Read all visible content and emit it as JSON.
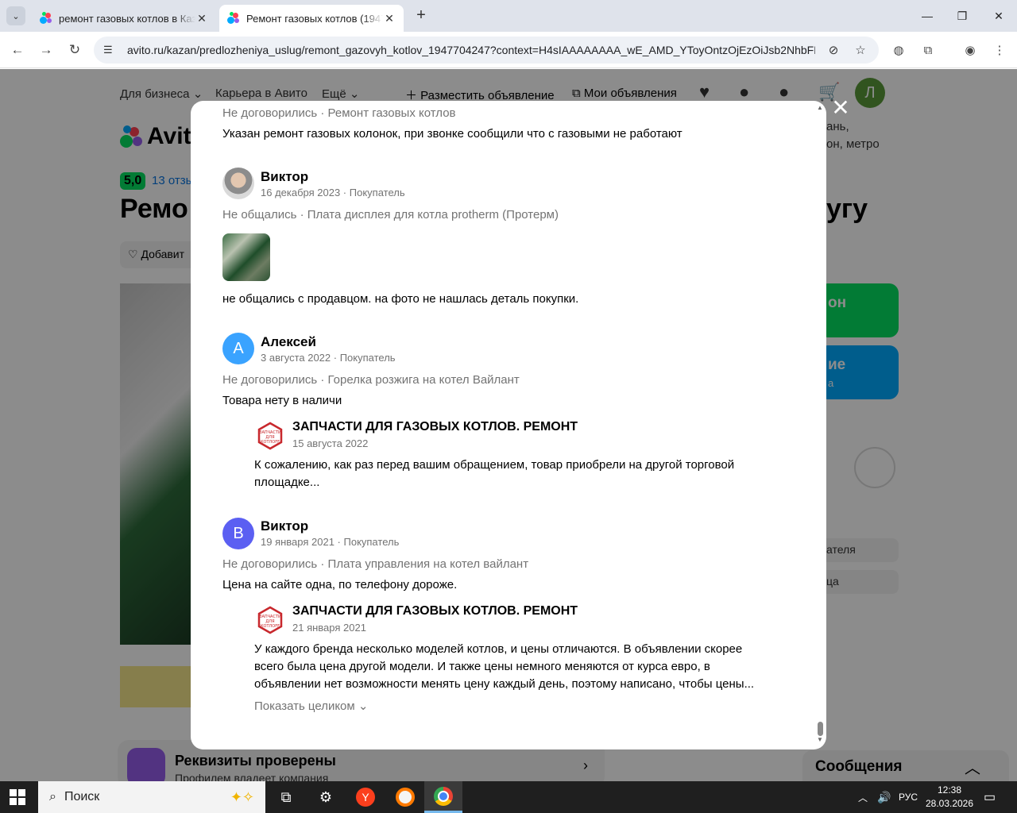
{
  "browser": {
    "tabs": [
      {
        "title": "ремонт газовых котлов в Каза",
        "active": false
      },
      {
        "title": "Ремонт газовых котлов (19477",
        "active": true
      }
    ],
    "url": "avito.ru/kazan/predlozheniya_uslug/remont_gazovyh_kotlov_1947704247?context=H4sIAAAAAAAA_wE_AMD_YToyOntzOjEzOiJsb2NhbFBya..."
  },
  "background_page": {
    "nav": {
      "business": "Для бизнеса",
      "career": "Карьера в Авито",
      "more": "Ещё",
      "post_ad": "Разместить объявление",
      "my_ads": "Мои объявления",
      "user_initial": "Л"
    },
    "logo_text": "Avito",
    "location_line1": "ань,",
    "location_line2": "он, метро",
    "rating_value": "5,0",
    "reviews_link": "13 отзы",
    "title_left": "Ремо",
    "title_right": "угу",
    "favorite_button": "Добавит",
    "call_button": "он",
    "message_button_1": "ие",
    "message_button_2": "а",
    "pill_1": "ателя",
    "pill_2": "ца",
    "verified_title": "Реквизиты проверены",
    "verified_subtitle": "Профилем владеет компания",
    "messages_title": "Сообщения"
  },
  "modal": {
    "reviews": [
      {
        "meta": "Не договорились · Ремонт газовых котлов",
        "text": "Указан ремонт газовых колонок, при звонке сообщили что с газовыми не работают"
      },
      {
        "name": "Виктор",
        "date": "16 декабря 2023 · Покупатель",
        "meta": "Не общались · Плата дисплея для котла protherm (Протерм)",
        "text": "не общались с продавцом. на фото не нашлась деталь покупки."
      },
      {
        "name": "Алексей",
        "initial": "А",
        "date": "3 августа 2022 · Покупатель",
        "meta": "Не договорились · Горелка розжига на котел Вайлант",
        "text": "Товара нету в наличи",
        "answer": {
          "seller": "ЗАПЧАСТИ ДЛЯ ГАЗОВЫХ КОТЛОВ. РЕМОНТ",
          "date": "15 августа 2022",
          "lines": [
            "К сожалению, как раз перед вашим обращением, товар приобрели на другой торговой",
            "площадке..."
          ]
        }
      },
      {
        "name": "Виктор",
        "initial": "В",
        "date": "19 января 2021 · Покупатель",
        "meta": "Не договорились · Плата управления на котел вайлант",
        "text": "Цена на сайте одна, по телефону дороже.",
        "answer": {
          "seller": "ЗАПЧАСТИ ДЛЯ ГАЗОВЫХ КОТЛОВ. РЕМОНТ",
          "date": "21 января 2021",
          "lines": [
            "У каждого бренда несколько моделей котлов, и цены отличаются. В объявлении скорее",
            "всего была цена другой модели. И также цены немного меняются от курса евро, в",
            "объявлении нет возможности менять цену каждый день, поэтому написано, чтобы цены..."
          ],
          "show_more": "Показать целиком"
        }
      }
    ],
    "seller_logo_text": [
      "ЗАПЧАСТИ",
      "ДЛЯ",
      "КОТЛОFF"
    ]
  },
  "taskbar": {
    "search_placeholder": "Поиск",
    "language": "РУС",
    "time": "12:38",
    "date": "28.03.2026"
  },
  "colors": {
    "avito_green": "#04e061",
    "avito_blue": "#00aaff",
    "avatar_blue_a": "#3aa3ff",
    "avatar_blue_b": "#5b5ff2",
    "seller_red": "#c8282d"
  }
}
